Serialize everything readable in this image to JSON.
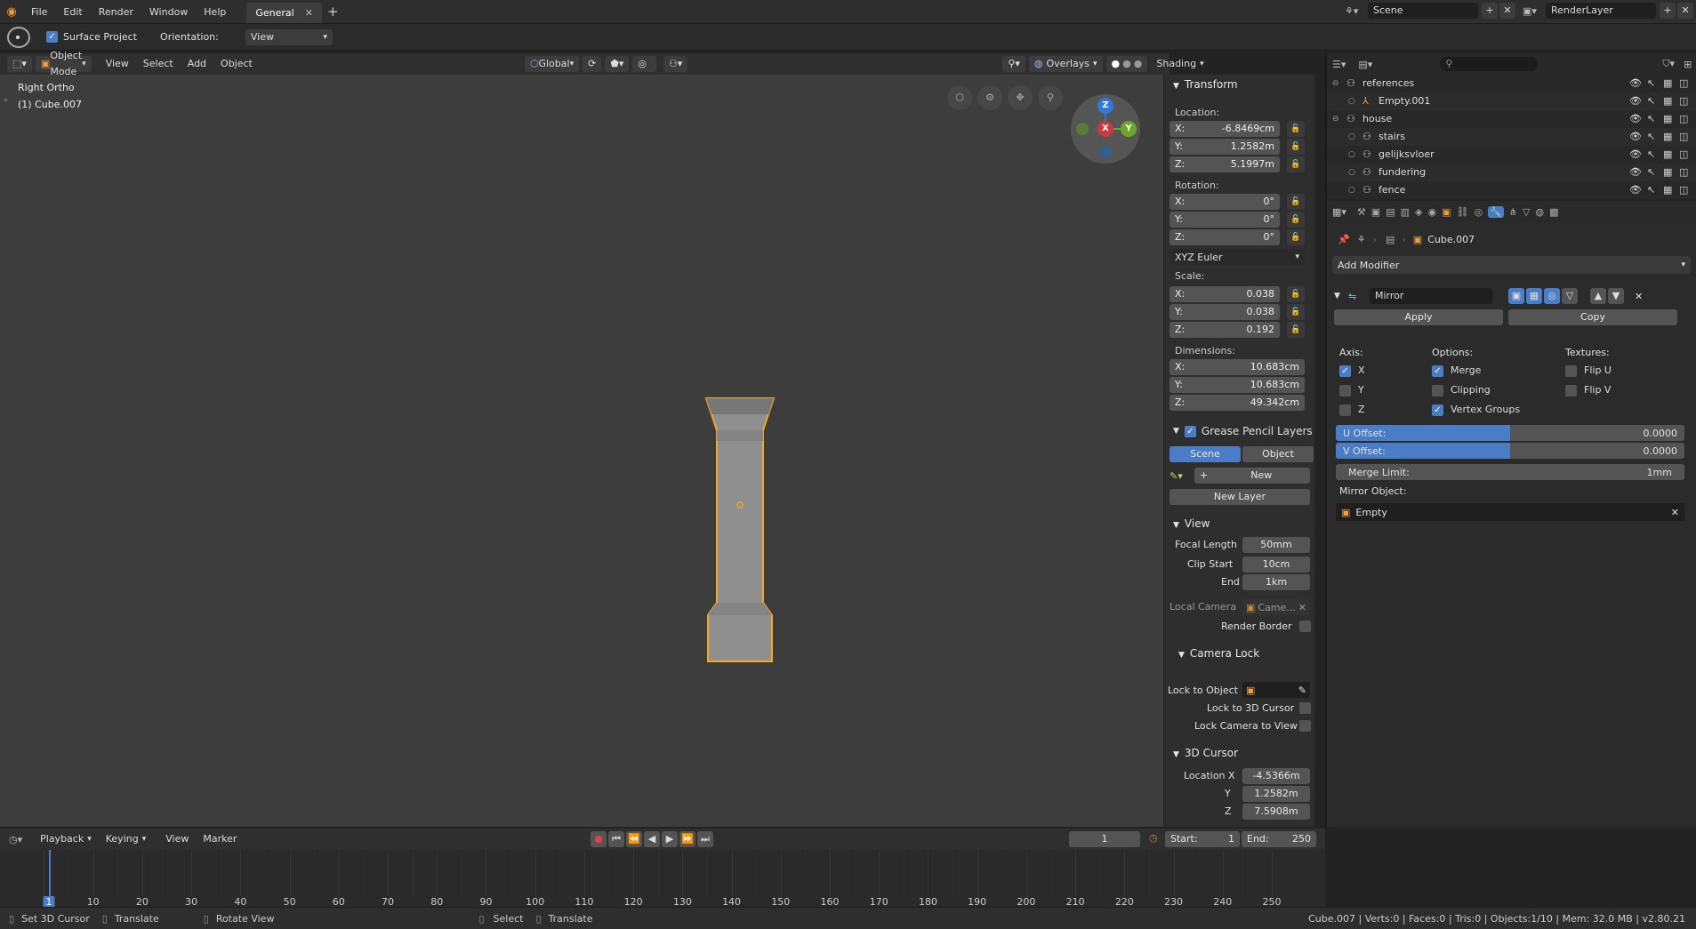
{
  "topbar": {
    "menus": [
      "File",
      "Edit",
      "Render",
      "Window",
      "Help"
    ],
    "workspace_tab": "General",
    "scene": "Scene",
    "render_layer": "RenderLayer"
  },
  "toolsettings": {
    "surface_project": "Surface Project",
    "orientation_label": "Orientation:",
    "orientation_value": "View"
  },
  "viewport_header": {
    "mode": "Object Mode",
    "menus": [
      "View",
      "Select",
      "Add",
      "Object"
    ],
    "transform_orientation": "Global",
    "overlays": "Overlays",
    "shading": "Shading"
  },
  "viewport": {
    "view_name": "Right Ortho",
    "object_name": "(1) Cube.007",
    "gizmo": {
      "z": "Z",
      "y": "Y",
      "x": "X"
    }
  },
  "npanel": {
    "transform": {
      "title": "Transform",
      "location_label": "Location:",
      "location": [
        {
          "axis": "X:",
          "value": "-6.8469cm"
        },
        {
          "axis": "Y:",
          "value": "1.2582m"
        },
        {
          "axis": "Z:",
          "value": "5.1997m"
        }
      ],
      "rotation_label": "Rotation:",
      "rotation": [
        {
          "axis": "X:",
          "value": "0°"
        },
        {
          "axis": "Y:",
          "value": "0°"
        },
        {
          "axis": "Z:",
          "value": "0°"
        }
      ],
      "rotation_mode": "XYZ Euler",
      "scale_label": "Scale:",
      "scale": [
        {
          "axis": "X:",
          "value": "0.038"
        },
        {
          "axis": "Y:",
          "value": "0.038"
        },
        {
          "axis": "Z:",
          "value": "0.192"
        }
      ],
      "dimensions_label": "Dimensions:",
      "dimensions": [
        {
          "axis": "X:",
          "value": "10.683cm"
        },
        {
          "axis": "Y:",
          "value": "10.683cm"
        },
        {
          "axis": "Z:",
          "value": "49.342cm"
        }
      ]
    },
    "grease_pencil": {
      "title": "Grease Pencil Layers",
      "scene_tab": "Scene",
      "object_tab": "Object",
      "new_label": "New",
      "new_layer_label": "New Layer"
    },
    "view": {
      "title": "View",
      "focal_length_label": "Focal Length",
      "focal_length": "50mm",
      "clip_start_label": "Clip Start",
      "clip_start": "10cm",
      "end_label": "End",
      "end": "1km",
      "local_camera_label": "Local Camera",
      "local_camera": "Came...",
      "render_border_label": "Render Border"
    },
    "camera_lock": {
      "title": "Camera Lock",
      "lock_to_object_label": "Lock to Object",
      "lock_to_3d_cursor_label": "Lock to 3D Cursor",
      "lock_camera_to_view_label": "Lock Camera to View"
    },
    "cursor": {
      "title": "3D Cursor",
      "loc_x_label": "Location X",
      "loc_x": "-4.5366m",
      "y_label": "Y",
      "loc_y": "1.2582m",
      "z_label": "Z",
      "loc_z": "7.5908m"
    }
  },
  "outliner": {
    "items": [
      {
        "name": "references",
        "indent": 0
      },
      {
        "name": "Empty.001",
        "indent": 1
      },
      {
        "name": "house",
        "indent": 0
      },
      {
        "name": "stairs",
        "indent": 1
      },
      {
        "name": "gelijksvloer",
        "indent": 1
      },
      {
        "name": "fundering",
        "indent": 1
      },
      {
        "name": "fence",
        "indent": 1
      }
    ]
  },
  "properties": {
    "object_name": "Cube.007",
    "add_modifier": "Add Modifier",
    "modifier": {
      "name": "Mirror",
      "apply": "Apply",
      "copy": "Copy",
      "axis_label": "Axis:",
      "options_label": "Options:",
      "textures_label": "Textures:",
      "axis": [
        {
          "label": "X",
          "on": true
        },
        {
          "label": "Y",
          "on": false
        },
        {
          "label": "Z",
          "on": false
        }
      ],
      "options": [
        {
          "label": "Merge",
          "on": true
        },
        {
          "label": "Clipping",
          "on": false
        },
        {
          "label": "Vertex Groups",
          "on": true
        }
      ],
      "textures": [
        {
          "label": "Flip U",
          "on": false
        },
        {
          "label": "Flip V",
          "on": false
        }
      ],
      "u_offset_label": "U Offset:",
      "u_offset": "0.0000",
      "v_offset_label": "V Offset:",
      "v_offset": "0.0000",
      "merge_limit_label": "Merge Limit:",
      "merge_limit": "1mm",
      "mirror_object_label": "Mirror Object:",
      "mirror_object": "Empty"
    }
  },
  "timeline": {
    "menus": [
      "Playback",
      "Keying",
      "View",
      "Marker"
    ],
    "current_frame": "1",
    "start_label": "Start:",
    "start": "1",
    "end_label": "End:",
    "end": "250",
    "ruler": [
      "1",
      "10",
      "20",
      "30",
      "40",
      "50",
      "60",
      "70",
      "80",
      "90",
      "100",
      "110",
      "120",
      "130",
      "140",
      "150",
      "160",
      "170",
      "180",
      "190",
      "200",
      "210",
      "220",
      "230",
      "240",
      "250"
    ]
  },
  "statusbar": {
    "left_items": [
      "Set 3D Cursor",
      "Translate",
      "Rotate View"
    ],
    "mid_items": [
      "Select",
      "Translate"
    ],
    "stats": "Cube.007 | Verts:0 | Faces:0 | Tris:0 | Objects:1/10 | Mem: 32.0 MB | v2.80.21"
  },
  "colors": {
    "accent": "#4a7dc6",
    "selection": "#f5a623",
    "viewport_bg": "#3d3d3d",
    "object": "#8f8f8f"
  }
}
